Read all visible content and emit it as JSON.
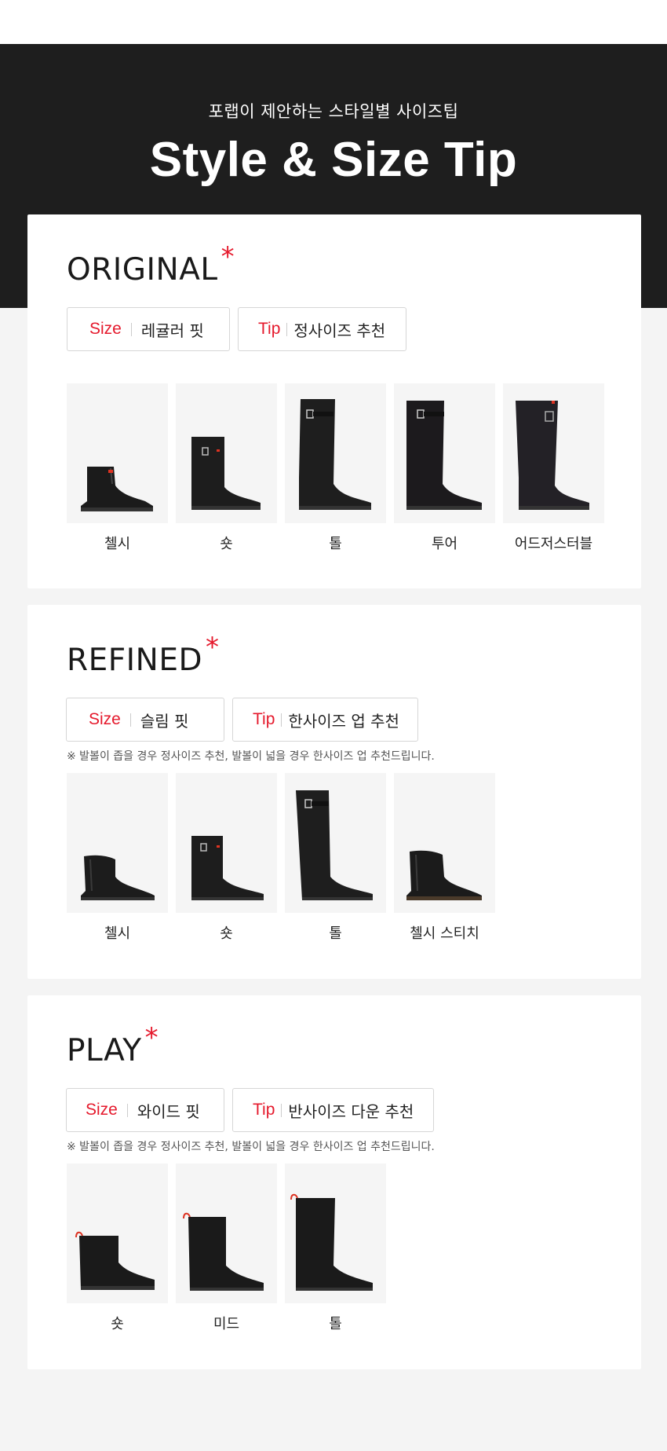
{
  "hero": {
    "subtitle": "포랩이 제안하는 스타일별 사이즈팁",
    "title": "Style & Size Tip"
  },
  "sections": [
    {
      "title": "ORIGINAL",
      "size_key": "Size",
      "size_value": "레귤러 핏",
      "tip_key": "Tip",
      "tip_value": "정사이즈 추천",
      "note": "",
      "items": [
        {
          "label": "첼시",
          "icon": "chelsea-boot"
        },
        {
          "label": "숏",
          "icon": "short-boot"
        },
        {
          "label": "톨",
          "icon": "tall-boot"
        },
        {
          "label": "투어",
          "icon": "tour-boot"
        },
        {
          "label": "어드저스터블",
          "icon": "adjustable-boot"
        }
      ]
    },
    {
      "title": "REFINED",
      "size_key": "Size",
      "size_value": "슬림 핏",
      "tip_key": "Tip",
      "tip_value": "한사이즈 업 추천",
      "note": "※ 발볼이 좁을 경우 정사이즈 추천, 발볼이 넓을 경우 한사이즈 업 추천드립니다.",
      "items": [
        {
          "label": "첼시",
          "icon": "chelsea-boot"
        },
        {
          "label": "숏",
          "icon": "short-boot"
        },
        {
          "label": "톨",
          "icon": "tall-boot"
        },
        {
          "label": "첼시 스티치",
          "icon": "chelsea-stitch-boot"
        }
      ]
    },
    {
      "title": "PLAY",
      "size_key": "Size",
      "size_value": "와이드 핏",
      "tip_key": "Tip",
      "tip_value": "반사이즈 다운 추천",
      "note": "※ 발볼이 좁을 경우 정사이즈 추천, 발볼이 넓을 경우 한사이즈 업 추천드립니다.",
      "items": [
        {
          "label": "숏",
          "icon": "play-short-boot"
        },
        {
          "label": "미드",
          "icon": "play-mid-boot"
        },
        {
          "label": "톨",
          "icon": "play-tall-boot"
        }
      ]
    }
  ],
  "colors": {
    "accent": "#e5192c",
    "hero_bg": "#1e1e1e",
    "tile_bg": "#f5f5f5"
  }
}
